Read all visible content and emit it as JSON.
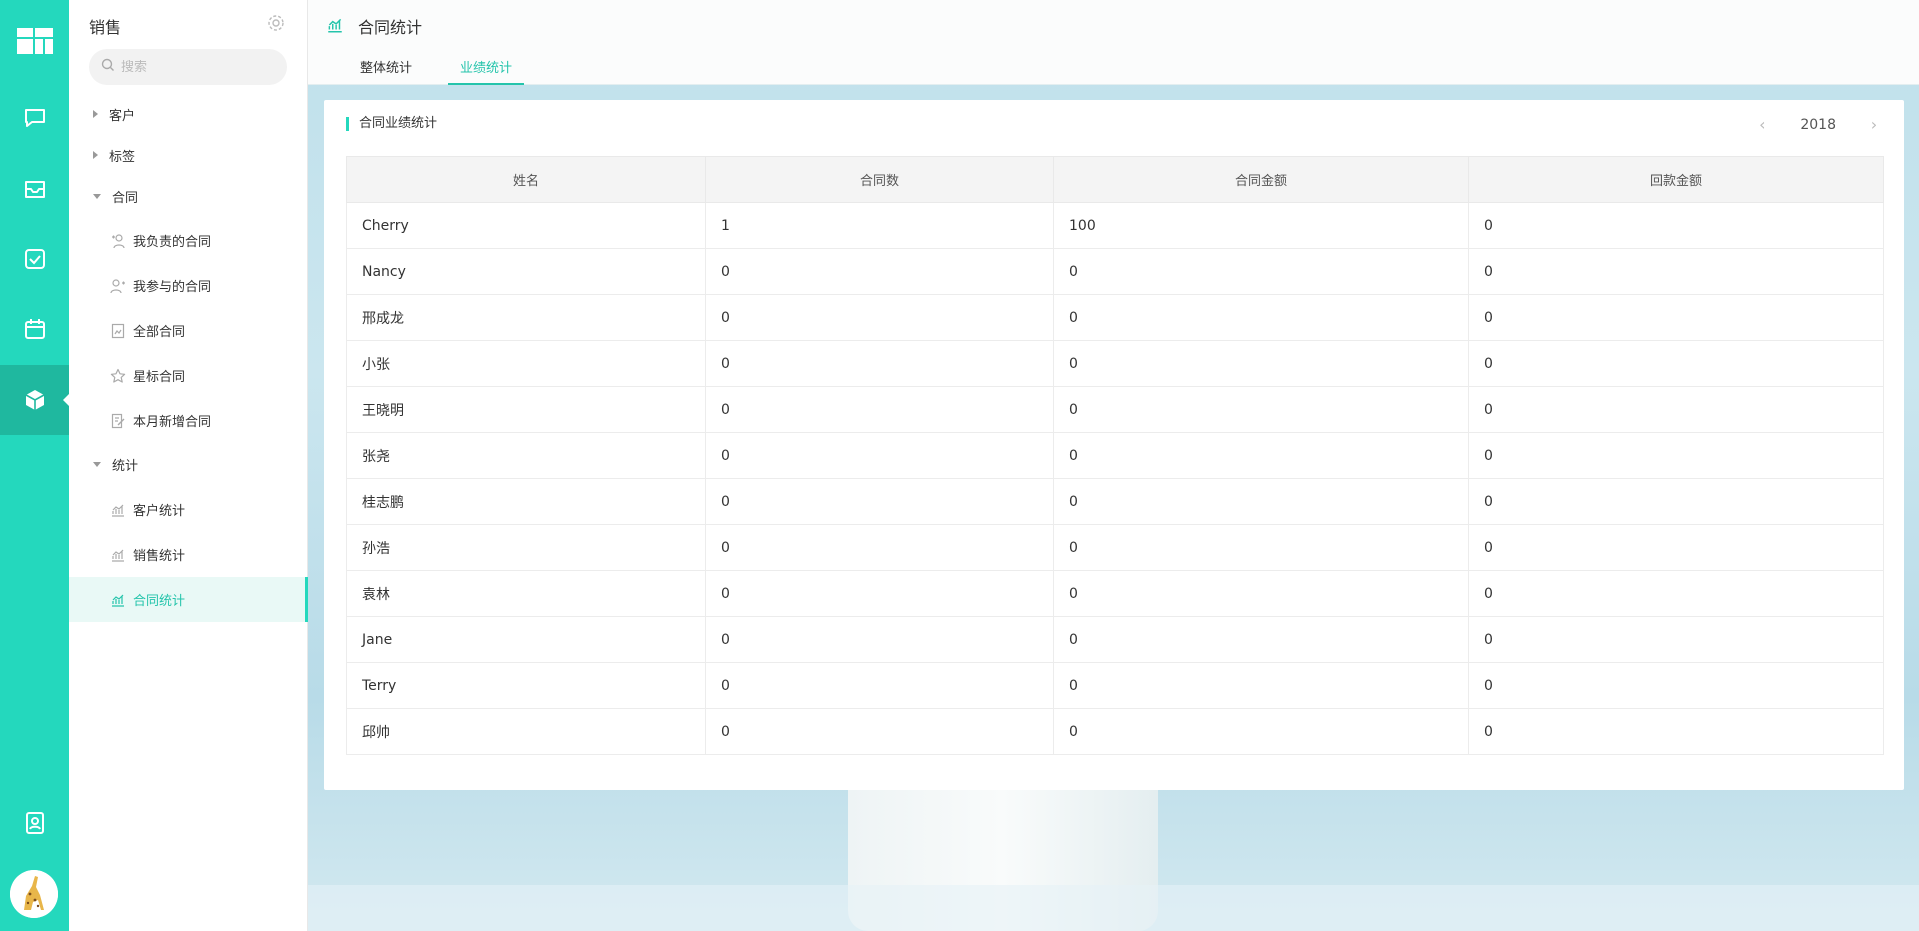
{
  "app": {
    "module_title": "销售",
    "page_title": "合同统计"
  },
  "search": {
    "placeholder": "搜索"
  },
  "rail_icons": [
    "logo-icon",
    "chat-icon",
    "inbox-icon",
    "task-icon",
    "calendar-icon",
    "cube-icon",
    "contacts-icon"
  ],
  "sidebar": {
    "groups": [
      {
        "label": "客户",
        "expanded": false
      },
      {
        "label": "标签",
        "expanded": false
      },
      {
        "label": "合同",
        "expanded": true
      },
      {
        "label": "统计",
        "expanded": true
      }
    ],
    "contract_items": [
      {
        "label": "我负责的合同",
        "icon": "person-star-icon"
      },
      {
        "label": "我参与的合同",
        "icon": "person-plus-icon"
      },
      {
        "label": "全部合同",
        "icon": "document-icon"
      },
      {
        "label": "星标合同",
        "icon": "star-icon"
      },
      {
        "label": "本月新增合同",
        "icon": "document-edit-icon"
      }
    ],
    "stats_items": [
      {
        "label": "客户统计",
        "icon": "chart-icon",
        "active": false
      },
      {
        "label": "销售统计",
        "icon": "chart-icon",
        "active": false
      },
      {
        "label": "合同统计",
        "icon": "chart-icon",
        "active": true
      }
    ]
  },
  "tabs": [
    {
      "label": "整体统计",
      "active": false
    },
    {
      "label": "业绩统计",
      "active": true
    }
  ],
  "card": {
    "title": "合同业绩统计",
    "year": "2018",
    "prev": "‹",
    "next": "›"
  },
  "table": {
    "headers": [
      "姓名",
      "合同数",
      "合同金额",
      "回款金额"
    ],
    "rows": [
      [
        "Cherry",
        "1",
        "100",
        "0"
      ],
      [
        "Nancy",
        "0",
        "0",
        "0"
      ],
      [
        "邢成龙",
        "0",
        "0",
        "0"
      ],
      [
        "小张",
        "0",
        "0",
        "0"
      ],
      [
        "王晓明",
        "0",
        "0",
        "0"
      ],
      [
        "张尧",
        "0",
        "0",
        "0"
      ],
      [
        "桂志鹏",
        "0",
        "0",
        "0"
      ],
      [
        "孙浩",
        "0",
        "0",
        "0"
      ],
      [
        "袁林",
        "0",
        "0",
        "0"
      ],
      [
        "Jane",
        "0",
        "0",
        "0"
      ],
      [
        "Terry",
        "0",
        "0",
        "0"
      ],
      [
        "邱帅",
        "0",
        "0",
        "0"
      ]
    ]
  },
  "colors": {
    "accent": "#24d8bd",
    "accent_dark": "#1fb89f",
    "accent_text": "#24c4ab"
  }
}
